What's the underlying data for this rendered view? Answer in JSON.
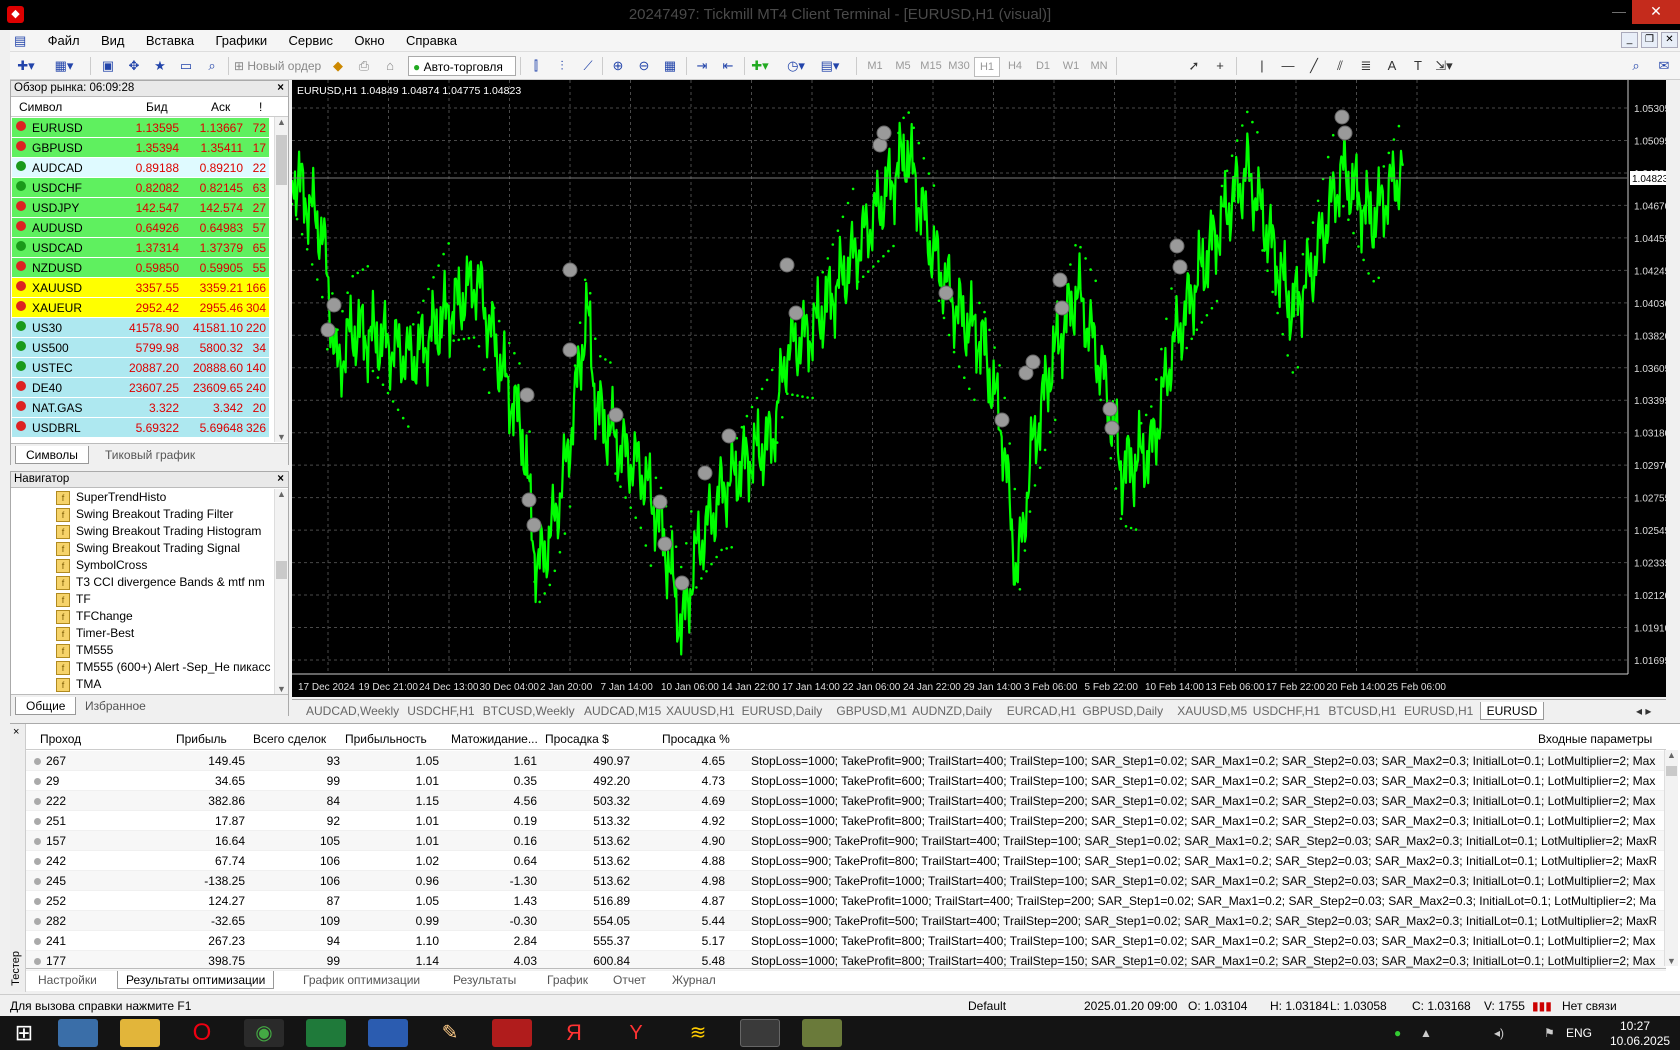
{
  "window": {
    "title": "20247497: Tickmill MT4 Client Terminal - [EURUSD,H1 (visual)]",
    "minimize": "—",
    "maximize": "☐",
    "close": "✕"
  },
  "menu": [
    "Файл",
    "Вид",
    "Вставка",
    "Графики",
    "Сервис",
    "Окно",
    "Справка"
  ],
  "toolbar": {
    "new_order": "Новый ордер",
    "auto_trading": "Авто-торговля",
    "timeframes": [
      "M1",
      "M5",
      "M15",
      "M30",
      "H1",
      "H4",
      "D1",
      "W1",
      "MN"
    ],
    "active_timeframe": "H1"
  },
  "market_watch": {
    "title": "Обзор рынка: 06:09:28",
    "columns": {
      "symbol": "Символ",
      "bid": "Бид",
      "ask": "Аск",
      "spread": "!"
    },
    "rows": [
      {
        "symbol": "EURUSD",
        "bid": "1.13595",
        "ask": "1.13667",
        "spread": "72",
        "bg": "#5ff05f",
        "dir": "down"
      },
      {
        "symbol": "GBPUSD",
        "bid": "1.35394",
        "ask": "1.35411",
        "spread": "17",
        "bg": "#5ff05f",
        "dir": "down"
      },
      {
        "symbol": "AUDCAD",
        "bid": "0.89188",
        "ask": "0.89210",
        "spread": "22",
        "bg": "#dffaff",
        "dir": "up"
      },
      {
        "symbol": "USDCHF",
        "bid": "0.82082",
        "ask": "0.82145",
        "spread": "63",
        "bg": "#5ff05f",
        "dir": "up"
      },
      {
        "symbol": "USDJPY",
        "bid": "142.547",
        "ask": "142.574",
        "spread": "27",
        "bg": "#5ff05f",
        "dir": "down"
      },
      {
        "symbol": "AUDUSD",
        "bid": "0.64926",
        "ask": "0.64983",
        "spread": "57",
        "bg": "#5ff05f",
        "dir": "down"
      },
      {
        "symbol": "USDCAD",
        "bid": "1.37314",
        "ask": "1.37379",
        "spread": "65",
        "bg": "#5ff05f",
        "dir": "up"
      },
      {
        "symbol": "NZDUSD",
        "bid": "0.59850",
        "ask": "0.59905",
        "spread": "55",
        "bg": "#5ff05f",
        "dir": "down"
      },
      {
        "symbol": "XAUUSD",
        "bid": "3357.55",
        "ask": "3359.21",
        "spread": "166",
        "bg": "#ffff00",
        "dir": "down"
      },
      {
        "symbol": "XAUEUR",
        "bid": "2952.42",
        "ask": "2955.46",
        "spread": "304",
        "bg": "#ffff00",
        "dir": "down"
      },
      {
        "symbol": "US30",
        "bid": "41578.90",
        "ask": "41581.10",
        "spread": "220",
        "bg": "#aee8f0",
        "dir": "up"
      },
      {
        "symbol": "US500",
        "bid": "5799.98",
        "ask": "5800.32",
        "spread": "34",
        "bg": "#aee8f0",
        "dir": "up"
      },
      {
        "symbol": "USTEC",
        "bid": "20887.20",
        "ask": "20888.60",
        "spread": "140",
        "bg": "#aee8f0",
        "dir": "up"
      },
      {
        "symbol": "DE40",
        "bid": "23607.25",
        "ask": "23609.65",
        "spread": "240",
        "bg": "#aee8f0",
        "dir": "down"
      },
      {
        "symbol": "NAT.GAS",
        "bid": "3.322",
        "ask": "3.342",
        "spread": "20",
        "bg": "#aee8f0",
        "dir": "down"
      },
      {
        "symbol": "USDBRL",
        "bid": "5.69322",
        "ask": "5.69648",
        "spread": "326",
        "bg": "#aee8f0",
        "dir": "down"
      }
    ],
    "tabs": [
      "Символы",
      "Тиковый график"
    ]
  },
  "navigator": {
    "title": "Навигатор",
    "items": [
      "SuperTrendHisto",
      "Swing Breakout Trading Filter",
      "Swing Breakout Trading Histogram",
      "Swing Breakout Trading Signal",
      "SymbolCross",
      "T3 CCI  divergence Bands & mtf nm",
      "TF",
      "TFChange",
      "Timer-Best",
      "TM555",
      "TM555 (600+) Alert -Sep_He пикасс",
      "TMA"
    ],
    "tabs": [
      "Общие",
      "Избранное"
    ]
  },
  "chart": {
    "header": "EURUSD,H1  1.04849 1.04874 1.04775 1.04823",
    "current_price": "1.04823",
    "price_labels": [
      "1.05305",
      "1.05095",
      "1.04880",
      "1.04670",
      "1.04455",
      "1.04245",
      "1.04030",
      "1.03820",
      "1.03605",
      "1.03395",
      "1.03180",
      "1.02970",
      "1.02755",
      "1.02545",
      "1.02335",
      "1.02120",
      "1.01910",
      "1.01695"
    ],
    "time_labels": [
      "17 Dec 2024",
      "19 Dec 21:00",
      "24 Dec 13:00",
      "30 Dec 04:00",
      "2 Jan 20:00",
      "7 Jan 14:00",
      "10 Jan 06:00",
      "14 Jan 22:00",
      "17 Jan 14:00",
      "22 Jan 06:00",
      "24 Jan 22:00",
      "29 Jan 14:00",
      "3 Feb 06:00",
      "5 Feb 22:00",
      "10 Feb 14:00",
      "13 Feb 06:00",
      "17 Feb 22:00",
      "20 Feb 14:00",
      "25 Feb 06:00"
    ],
    "colors": {
      "bg": "#000000",
      "candles": "#00ff00",
      "grid": "#4a4a4a"
    }
  },
  "chart_tabs": [
    "AUDCAD,Weekly",
    "USDCHF,H1",
    "BTCUSD,Weekly",
    "AUDCAD,M15",
    "XAUUSD,H1",
    "EURUSD,Daily",
    "GBPUSD,M1",
    "AUDNZD,Daily",
    "EURCAD,H1",
    "GBPUSD,Daily",
    "XAUUSD,M5",
    "USDCHF,H1",
    "BTCUSD,H1",
    "EURUSD,H1",
    "EURUSD"
  ],
  "active_chart_tab": "EURUSD",
  "tester": {
    "label": "Тестер",
    "columns": {
      "pass": "Проход",
      "profit": "Прибыль",
      "trades": "Всего сделок",
      "pf": "Прибыльность",
      "expect": "Матожидание...",
      "dd_money": "Просадка $",
      "dd_pct": "Просадка %",
      "params": "Входные параметры"
    },
    "rows": [
      {
        "pass": "267",
        "profit": "149.45",
        "trades": "93",
        "pf": "1.05",
        "expect": "1.61",
        "dd": "490.97",
        "ddp": "4.65",
        "params": "StopLoss=1000; TakeProfit=900; TrailStart=400; TrailStep=100; SAR_Step1=0.02; SAR_Max1=0.2; SAR_Step2=0.03; SAR_Max2=0.3; InitialLot=0.1; LotMultiplier=2; MaxReversal..."
      },
      {
        "pass": "29",
        "profit": "34.65",
        "trades": "99",
        "pf": "1.01",
        "expect": "0.35",
        "dd": "492.20",
        "ddp": "4.73",
        "params": "StopLoss=1000; TakeProfit=600; TrailStart=400; TrailStep=100; SAR_Step1=0.02; SAR_Max1=0.2; SAR_Step2=0.03; SAR_Max2=0.3; InitialLot=0.1; LotMultiplier=2; MaxReversal..."
      },
      {
        "pass": "222",
        "profit": "382.86",
        "trades": "84",
        "pf": "1.15",
        "expect": "4.56",
        "dd": "503.32",
        "ddp": "4.69",
        "params": "StopLoss=1000; TakeProfit=900; TrailStart=400; TrailStep=200; SAR_Step1=0.02; SAR_Max1=0.2; SAR_Step2=0.03; SAR_Max2=0.3; InitialLot=0.1; LotMultiplier=2; MaxReversal..."
      },
      {
        "pass": "251",
        "profit": "17.87",
        "trades": "92",
        "pf": "1.01",
        "expect": "0.19",
        "dd": "513.32",
        "ddp": "4.92",
        "params": "StopLoss=1000; TakeProfit=800; TrailStart=400; TrailStep=200; SAR_Step1=0.02; SAR_Max1=0.2; SAR_Step2=0.03; SAR_Max2=0.3; InitialLot=0.1; LotMultiplier=2; MaxReversal..."
      },
      {
        "pass": "157",
        "profit": "16.64",
        "trades": "105",
        "pf": "1.01",
        "expect": "0.16",
        "dd": "513.62",
        "ddp": "4.90",
        "params": "StopLoss=900; TakeProfit=900; TrailStart=400; TrailStep=100; SAR_Step1=0.02; SAR_Max1=0.2; SAR_Step2=0.03; SAR_Max2=0.3; InitialLot=0.1; LotMultiplier=2; MaxReversals..."
      },
      {
        "pass": "242",
        "profit": "67.74",
        "trades": "106",
        "pf": "1.02",
        "expect": "0.64",
        "dd": "513.62",
        "ddp": "4.88",
        "params": "StopLoss=900; TakeProfit=800; TrailStart=400; TrailStep=100; SAR_Step1=0.02; SAR_Max1=0.2; SAR_Step2=0.03; SAR_Max2=0.3; InitialLot=0.1; LotMultiplier=2; MaxReversals..."
      },
      {
        "pass": "245",
        "profit": "-138.25",
        "trades": "106",
        "pf": "0.96",
        "expect": "-1.30",
        "dd": "513.62",
        "ddp": "4.98",
        "params": "StopLoss=900; TakeProfit=1000; TrailStart=400; TrailStep=100; SAR_Step1=0.02; SAR_Max1=0.2; SAR_Step2=0.03; SAR_Max2=0.3; InitialLot=0.1; LotMultiplier=2; MaxReversal..."
      },
      {
        "pass": "252",
        "profit": "124.27",
        "trades": "87",
        "pf": "1.05",
        "expect": "1.43",
        "dd": "516.89",
        "ddp": "4.87",
        "params": "StopLoss=1000; TakeProfit=1000; TrailStart=400; TrailStep=200; SAR_Step1=0.02; SAR_Max1=0.2; SAR_Step2=0.03; SAR_Max2=0.3; InitialLot=0.1; LotMultiplier=2; MaxRevers..."
      },
      {
        "pass": "282",
        "profit": "-32.65",
        "trades": "109",
        "pf": "0.99",
        "expect": "-0.30",
        "dd": "554.05",
        "ddp": "5.44",
        "params": "StopLoss=900; TakeProfit=500; TrailStart=400; TrailStep=200; SAR_Step1=0.02; SAR_Max1=0.2; SAR_Step2=0.03; SAR_Max2=0.3; InitialLot=0.1; LotMultiplier=2; MaxReversals..."
      },
      {
        "pass": "241",
        "profit": "267.23",
        "trades": "94",
        "pf": "1.10",
        "expect": "2.84",
        "dd": "555.37",
        "ddp": "5.17",
        "params": "StopLoss=1000; TakeProfit=800; TrailStart=400; TrailStep=100; SAR_Step1=0.02; SAR_Max1=0.2; SAR_Step2=0.03; SAR_Max2=0.3; InitialLot=0.1; LotMultiplier=2; MaxReversal..."
      },
      {
        "pass": "177",
        "profit": "398.75",
        "trades": "99",
        "pf": "1.14",
        "expect": "4.03",
        "dd": "600.84",
        "ddp": "5.48",
        "params": "StopLoss=1000; TakeProfit=800; TrailStart=400; TrailStep=150; SAR_Step1=0.02; SAR_Max1=0.2; SAR_Step2=0.03; SAR_Max2=0.3; InitialLot=0.1; LotMultiplier=2; MaxReversal..."
      }
    ],
    "tabs": [
      "Настройки",
      "Результаты оптимизации",
      "График оптимизации",
      "Результаты",
      "График",
      "Отчет",
      "Журнал"
    ],
    "active_tab": "Результаты оптимизации"
  },
  "status": {
    "help": "Для вызова справки нажмите F1",
    "profile": "Default",
    "datetime": "2025.01.20 09:00",
    "open": "O: 1.03104",
    "high": "H: 1.03184",
    "low": "L: 1.03058",
    "close": "C: 1.03168",
    "volume": "V: 1755",
    "connection": "Нет связи"
  },
  "taskbar": {
    "lang": "ENG",
    "time": "10:27",
    "date": "10.06.2025"
  }
}
